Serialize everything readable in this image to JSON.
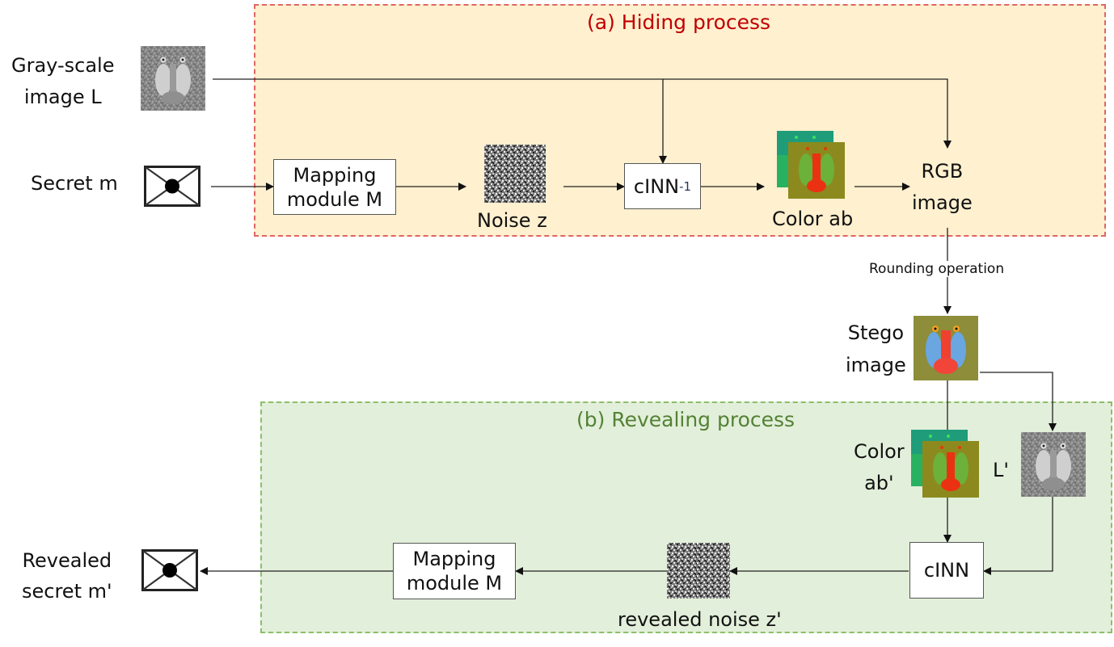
{
  "diagram": {
    "panels": {
      "hiding": {
        "title": "(a) Hiding process",
        "border_color": "#e06666",
        "fill_color": "#fff0cf",
        "title_color": "#c00000"
      },
      "revealing": {
        "title": "(b) Revealing process",
        "border_color": "#8cbf6a",
        "fill_color": "#e2efda",
        "title_color": "#548235"
      }
    },
    "inputs": {
      "grayscale_label_line1": "Gray-scale",
      "grayscale_label_line2": "image L",
      "secret_label": "Secret m"
    },
    "hiding": {
      "mapping_line1": "Mapping",
      "mapping_line2": "module M",
      "noise_label": "Noise z",
      "cinn_inverse_base": "cINN",
      "cinn_inverse_sup": "-1",
      "color_label": "Color ab",
      "rgb_line1": "RGB",
      "rgb_line2": "image"
    },
    "transition": {
      "rounding_label": "Rounding operation",
      "stego_line1": "Stego",
      "stego_line2": "image"
    },
    "revealing": {
      "color_line1": "Color",
      "color_line2": "ab'",
      "l_prime_label": "L'",
      "cinn_label": "cINN",
      "noise_label": "revealed noise z'",
      "mapping_line1": "Mapping",
      "mapping_line2": "module M",
      "output_line1": "Revealed",
      "output_line2": "secret m'"
    },
    "icons": {
      "grayscale_image": "mandrill-grayscale-thumbnail",
      "secret": "envelope-icon",
      "noise": "noise-pattern",
      "color_ab": "color-ab-channels",
      "stego": "mandrill-color-thumbnail"
    }
  }
}
